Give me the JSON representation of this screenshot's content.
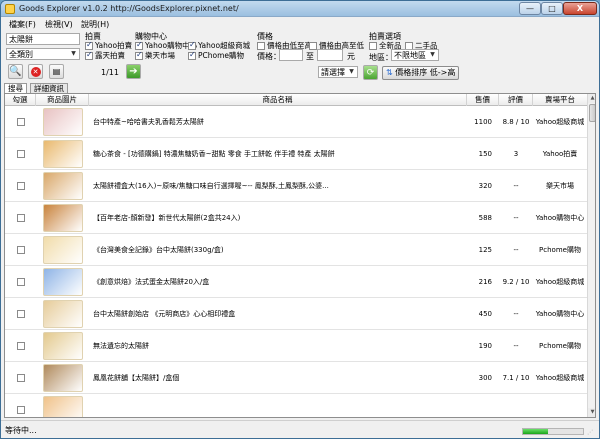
{
  "window": {
    "title": "Goods Explorer v1.0.2   http://GoodsExplorer.pixnet.net/",
    "min_label": "—",
    "max_label": "□",
    "close_label": "X"
  },
  "menu": [
    "檔案(F)",
    "檢視(V)",
    "說明(H)"
  ],
  "search": {
    "keyword": "太陽餅",
    "category": "全類別",
    "page": "1/11"
  },
  "auction": {
    "title": "拍賣",
    "items": [
      {
        "label": "Yahoo拍賣",
        "checked": true
      },
      {
        "label": "露天拍賣",
        "checked": true
      }
    ]
  },
  "shopping": {
    "title": "購物中心",
    "items": [
      {
        "label": "Yahoo購物中心",
        "checked": true
      },
      {
        "label": "Yahoo超級商城",
        "checked": true
      },
      {
        "label": "樂天市場",
        "checked": true
      },
      {
        "label": "PChome購物",
        "checked": true
      }
    ]
  },
  "price": {
    "title": "價格",
    "low_to_high": "價格由低至高",
    "high_to_low": "價格由高至低",
    "range_label": "價格：",
    "to_label": "至",
    "unit": "元",
    "min_value": "",
    "max_value": ""
  },
  "auction_options": {
    "title": "拍賣選項",
    "new_label": "全新品",
    "used_label": "二手品",
    "region_label": "地區：",
    "region_value": "不限地區"
  },
  "sort": {
    "select_value": "請選擇",
    "sort_button": "價格排序 低->高"
  },
  "tabs": [
    "搜尋",
    "詳細資訊"
  ],
  "columns": [
    "勾選",
    "商品圖片",
    "商品名稱",
    "售價",
    "評價",
    "賣場平台"
  ],
  "rows": [
    {
      "name": "台中特產~哈哈書夫乳香鬆芳太陽餅",
      "price": "1100",
      "rating": "8.8 / 10",
      "platform": "Yahoo超級商城",
      "thumb": "#e8c2c2"
    },
    {
      "name": "糖心茶食 - [功德購鍋] 特濃焦糖奶香~甜點 零食 手工餅乾 伴手禮 特產 太陽餅",
      "price": "150",
      "rating": "3",
      "platform": "Yahoo拍賣",
      "thumb": "#e9b96e"
    },
    {
      "name": "太陽餅禮盒大(16入)~原味/焦糖口味自行選擇喔~-- 鳳梨酥,土鳳梨酥,公婆...",
      "price": "320",
      "rating": "--",
      "platform": "樂天市場",
      "thumb": "#d9a86a"
    },
    {
      "name": "【百年老店-顏新發】新世代太陽餅(2盒共24入)",
      "price": "588",
      "rating": "--",
      "platform": "Yahoo購物中心",
      "thumb": "#c9843e"
    },
    {
      "name": "《台灣美食全記錄》台中太陽餅(330g/盒)",
      "price": "125",
      "rating": "--",
      "platform": "Pchome購物",
      "thumb": "#f1dcaa"
    },
    {
      "name": "《創意烘焙》法式蛋金太陽餅20入/盒",
      "price": "216",
      "rating": "9.2 / 10",
      "platform": "Yahoo超級商城",
      "thumb": "#8fb4e6"
    },
    {
      "name": "台中太陽餅創始店 《元明商店》心心相印禮盒",
      "price": "450",
      "rating": "--",
      "platform": "Yahoo購物中心",
      "thumb": "#e6cc9a"
    },
    {
      "name": "無法遺忘的太陽餅",
      "price": "190",
      "rating": "--",
      "platform": "Pchome購物",
      "thumb": "#e3c98e"
    },
    {
      "name": "鳳凰花餅舖【太陽餅】/盒個",
      "price": "300",
      "rating": "7.1 / 10",
      "platform": "Yahoo超級商城",
      "thumb": "#b08a5c"
    },
    {
      "name": "",
      "price": "",
      "rating": "",
      "platform": "",
      "thumb": "#f0c28a"
    }
  ],
  "status": {
    "text": "等待中...",
    "progress": 0.42
  }
}
